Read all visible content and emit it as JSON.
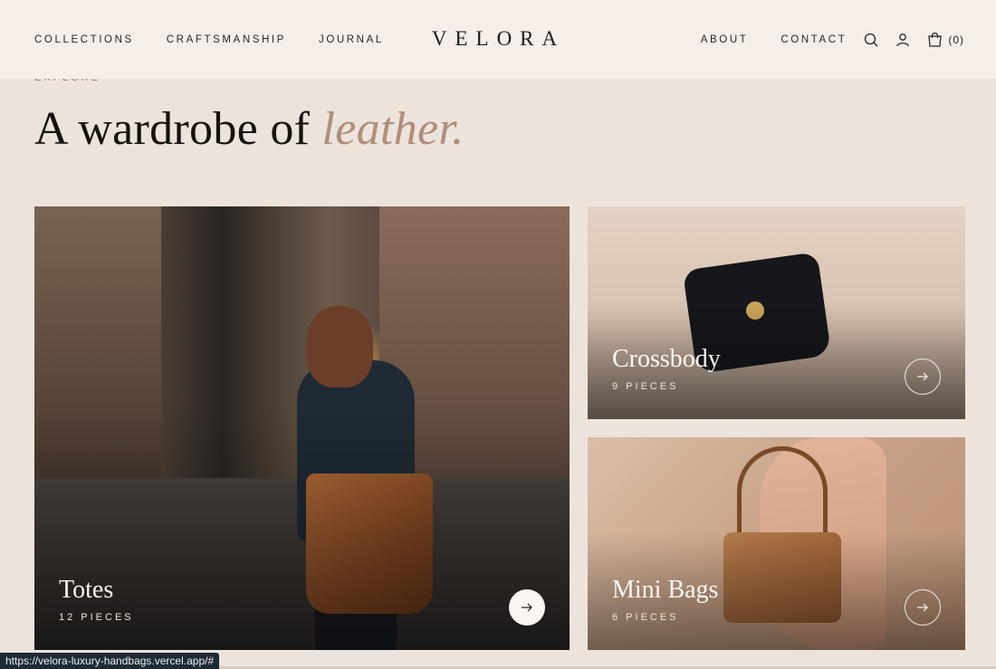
{
  "header": {
    "nav_left": [
      "COLLECTIONS",
      "CRAFTSMANSHIP",
      "JOURNAL"
    ],
    "logo": "VELORA",
    "nav_right": [
      "ABOUT",
      "CONTACT"
    ],
    "icons": [
      "search-icon",
      "account-icon",
      "cart-icon"
    ],
    "cart_count": "(0)"
  },
  "intro": {
    "eyebrow": "EXPLORE",
    "heading_plain": "A wardrobe of ",
    "heading_accent": "leather."
  },
  "cards": [
    {
      "title": "Totes",
      "count": "12 PIECES"
    },
    {
      "title": "Crossbody",
      "count": "9 PIECES"
    },
    {
      "title": "Mini Bags",
      "count": "6 PIECES"
    }
  ],
  "status_bar": {
    "url": "https://velora-luxury-handbags.vercel.app/#"
  },
  "colors": {
    "accent": "#b08e78",
    "background": "#ede3dd",
    "header": "#f6eee9"
  }
}
